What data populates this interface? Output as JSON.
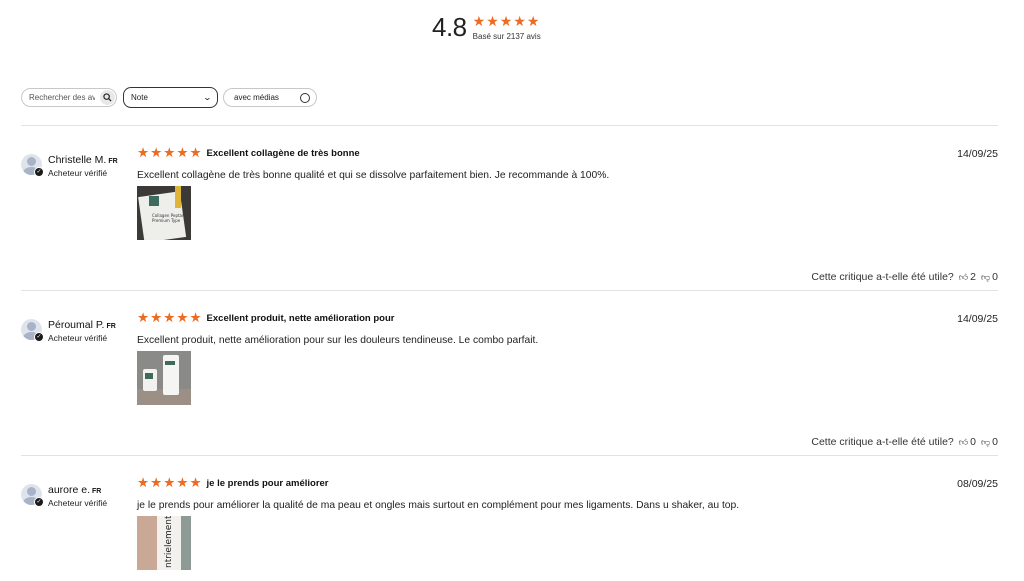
{
  "summary": {
    "average": "4.8",
    "stars": 5,
    "based_on": "Basé sur 2137 avis",
    "star_color": "#ee6b1f"
  },
  "filters": {
    "search_placeholder": "Rechercher des avis",
    "rating_select": "Note",
    "media_label": "avec médias"
  },
  "reviews": [
    {
      "author": "Christelle M.",
      "country": "FR",
      "verified": "Acheteur vérifié",
      "rating": 5,
      "title": "Excellent collagène de très bonne",
      "date": "14/09/25",
      "body": "Excellent collagène de très bonne qualité et qui se dissolve parfaitement bien. Je recommande à 100%.",
      "helpful_prompt": "Cette critique a-t-elle été utile?",
      "up_votes": "2",
      "down_votes": "0"
    },
    {
      "author": "Péroumal P.",
      "country": "FR",
      "verified": "Acheteur vérifié",
      "rating": 5,
      "title": "Excellent produit, nette amélioration pour",
      "date": "14/09/25",
      "body": "Excellent produit, nette amélioration pour sur les douleurs tendineuse. Le combo parfait.",
      "helpful_prompt": "Cette critique a-t-elle été utile?",
      "up_votes": "0",
      "down_votes": "0"
    },
    {
      "author": "aurore e.",
      "country": "FR",
      "verified": "Acheteur vérifié",
      "rating": 5,
      "title": "je le prends pour améliorer",
      "date": "08/09/25",
      "body": "je le prends pour améliorer la qualité de ma peau et ongles mais surtout en complément pour mes ligaments. Dans u shaker, au top."
    }
  ]
}
